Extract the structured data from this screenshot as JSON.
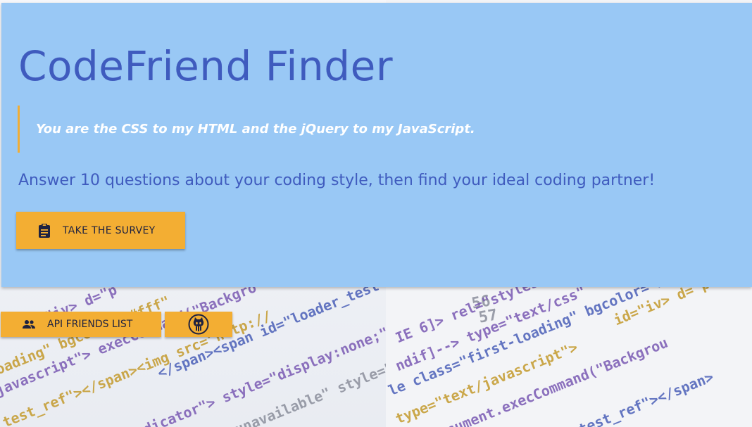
{
  "hero": {
    "title": "CodeFriend Finder",
    "quote": "You are the CSS to my HTML and the jQuery to my JavaScript.",
    "tagline": "Answer 10 questions about your coding style, then find your ideal coding partner!",
    "survey_button": {
      "label": "TAKE THE SURVEY",
      "icon": "clipboard-icon"
    }
  },
  "footer_buttons": {
    "friends_button": {
      "label": "API FRIENDS LIST",
      "icon": "people-icon"
    },
    "github_button": {
      "icon": "github-octocat-icon"
    }
  },
  "colors": {
    "panel": "#99c8f5",
    "title": "#3f5bbe",
    "accent": "#f3ae33",
    "quote_border": "#f0ad36"
  }
}
